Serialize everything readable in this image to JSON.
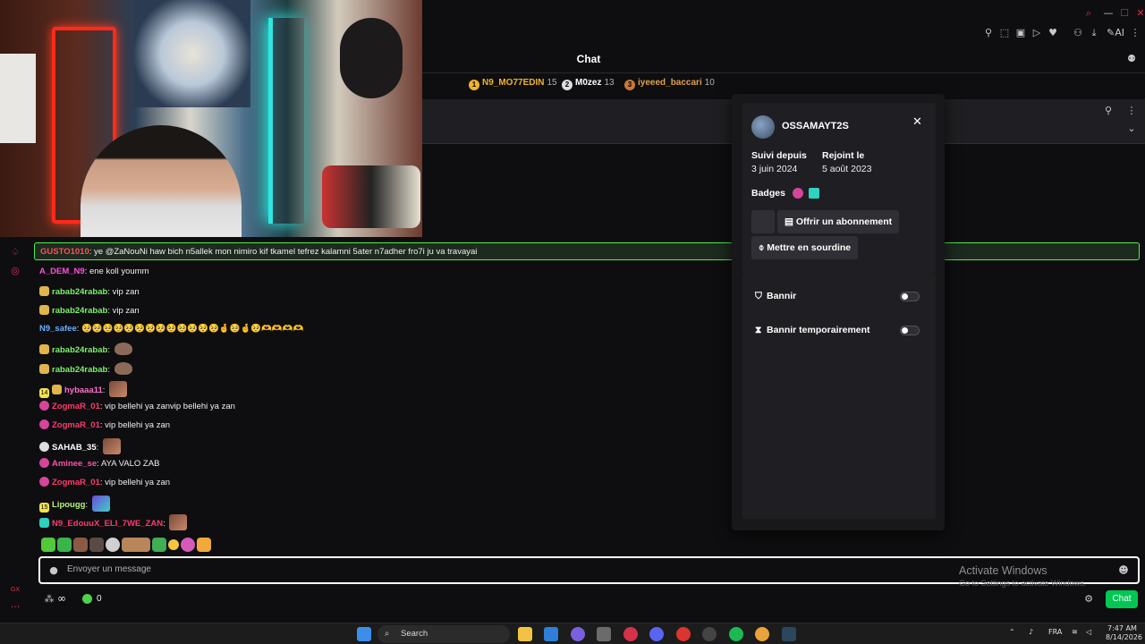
{
  "chat_header": {
    "title": "Chat"
  },
  "leaderboard": [
    {
      "rank": "1",
      "name": "N9_MO77EDIN",
      "score": "15",
      "color": "#f0b429"
    },
    {
      "rank": "2",
      "name": "M0zez",
      "score": "13",
      "color": "#ffffff"
    },
    {
      "rank": "3",
      "name": "iyeeed_baccari",
      "score": "10",
      "color": "#e0a04b"
    }
  ],
  "highlighted_message": {
    "user": "GUSTO1010",
    "user_color": "#ff4f5a",
    "text": "ye @ZaNouNi haw bich n5allek mon nimiro kif tkamel tefrez kalamni 5ater n7adher fro7i ju va travayai"
  },
  "messages": [
    {
      "user": "A_DEM_N9",
      "color": "#ff4fd8",
      "text": "ene koll youmm",
      "badge": "",
      "emotes": 0
    },
    {
      "user": "rabab24rabab",
      "color": "#7cf26b",
      "text": "vip zan",
      "badge": "gift",
      "emotes": 0
    },
    {
      "user": "rabab24rabab",
      "color": "#7cf26b",
      "text": "vip zan",
      "badge": "gift",
      "emotes": 0
    },
    {
      "user": "N9_safee",
      "color": "#6ab0ff",
      "text": "",
      "badge": "",
      "emotes": 0,
      "emoji_row": "🥺🥺🥺🥺🥺🥺🥺🥺🥺🥺🥺🥺🥺🤞🥺🤞🥺🫶🫶🫶🫶"
    },
    {
      "user": "rabab24rabab",
      "color": "#7cf26b",
      "text": "",
      "badge": "gift",
      "emotes": 1
    },
    {
      "user": "rabab24rabab",
      "color": "#7cf26b",
      "text": "",
      "badge": "gift",
      "emotes": 1
    },
    {
      "user": "hybaaa11",
      "color": "#ff6fd0",
      "text": "",
      "badge": "14",
      "emotes": 1
    },
    {
      "user": "ZogmaR_01",
      "color": "#ff3b6b",
      "text": "vip bellehi ya zanvip bellehi ya zan",
      "badge": "sub",
      "emotes": 0
    },
    {
      "user": "ZogmaR_01",
      "color": "#ff3b6b",
      "text": "vip bellehi ya zan",
      "badge": "sub",
      "emotes": 0
    },
    {
      "user": "SAHAB_35",
      "color": "#ffffff",
      "text": "",
      "badge": "round",
      "emotes": 1
    },
    {
      "user": "Aminee_se",
      "color": "#ff4fa8",
      "text": "AYA VALO ZAB",
      "badge": "sub",
      "emotes": 0
    },
    {
      "user": "ZogmaR_01",
      "color": "#ff3b6b",
      "text": "vip bellehi ya zan",
      "badge": "sub",
      "emotes": 0
    },
    {
      "user": "Lipougg",
      "color": "#b9f27c",
      "text": "",
      "badge": "15",
      "emotes": 1
    },
    {
      "user": "N9_EdouuX_ELI_7WE_ZAN",
      "color": "#ff3b6b",
      "text": "",
      "badge": "og",
      "emotes": 1
    }
  ],
  "input": {
    "placeholder": "Envoyer un message"
  },
  "watermark": {
    "title": "Activate Windows",
    "subtitle": "Go to Settings to activate Windows."
  },
  "bottom": {
    "points": "0",
    "infinity": "∞",
    "chat_button": "Chat"
  },
  "user_card": {
    "username": "OSSAMAYT2S",
    "followed_label": "Suivi depuis",
    "followed_value": "3 juin 2024",
    "joined_label": "Rejoint le",
    "joined_value": "5 août 2023",
    "badges_label": "Badges",
    "gift_button": "Offrir un abonnement",
    "mute_button": "Mettre en sourdine",
    "ban_label": "Bannir",
    "timeout_label": "Bannir temporairement"
  },
  "taskbar": {
    "search": "Search",
    "language": "FRA",
    "time": "7:47 AM",
    "date": "8/14/2026"
  },
  "colors": {
    "accent_green": "#00c853",
    "highlight_border": "#4ff051",
    "kick_dark": "#0e0e10"
  }
}
